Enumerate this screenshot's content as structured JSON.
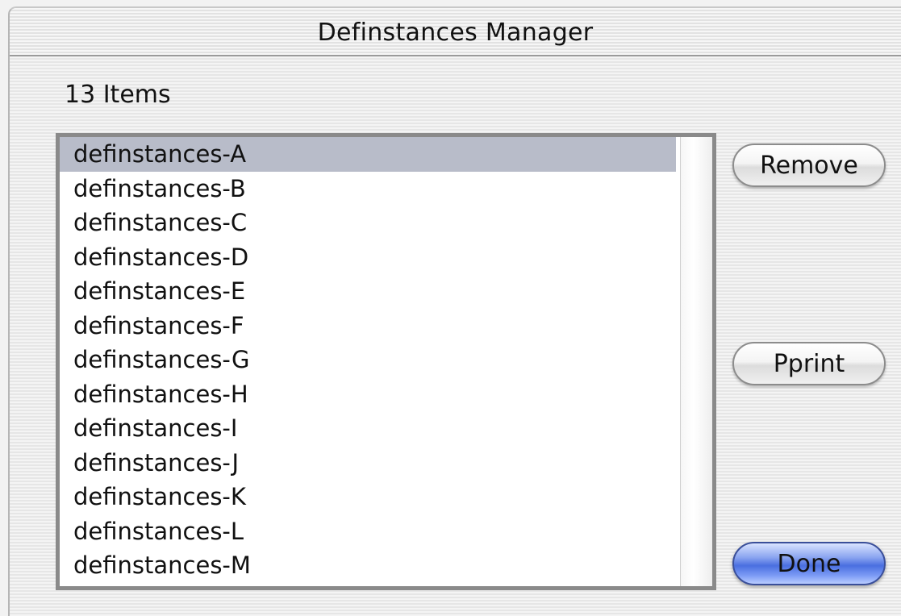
{
  "window": {
    "title": "Definstances Manager"
  },
  "header": {
    "count_label": "13 Items"
  },
  "list": {
    "selected_index": 0,
    "items": [
      "definstances-A",
      "definstances-B",
      "definstances-C",
      "definstances-D",
      "definstances-E",
      "definstances-F",
      "definstances-G",
      "definstances-H",
      "definstances-I",
      "definstances-J",
      "definstances-K",
      "definstances-L",
      "definstances-M"
    ]
  },
  "buttons": {
    "remove_label": "Remove",
    "pprint_label": "Pprint",
    "done_label": "Done"
  },
  "colors": {
    "selection": "#b8bcc9",
    "default_button": "#4a6fe0"
  }
}
